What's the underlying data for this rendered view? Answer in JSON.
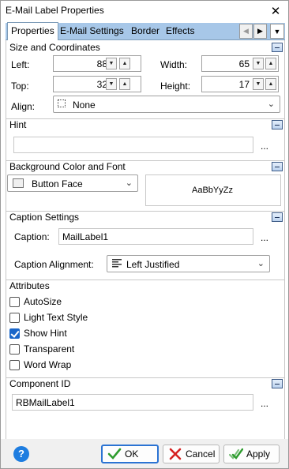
{
  "window": {
    "title": "E-Mail Label Properties"
  },
  "tabs": [
    "Properties",
    "E-Mail Settings",
    "Border",
    "Effects"
  ],
  "size": {
    "header": "Size and Coordinates",
    "left_label": "Left:",
    "left_value": "88",
    "width_label": "Width:",
    "width_value": "65",
    "top_label": "Top:",
    "top_value": "32",
    "height_label": "Height:",
    "height_value": "17",
    "align_label": "Align:",
    "align_value": "None"
  },
  "hint": {
    "header": "Hint",
    "value": "",
    "browse": "..."
  },
  "background": {
    "header": "Background Color and Font",
    "color_value": "Button Face",
    "font_preview": "AaBbYyZz"
  },
  "caption": {
    "header": "Caption Settings",
    "caption_label": "Caption:",
    "caption_value": "MailLabel1",
    "browse": "...",
    "alignment_label": "Caption Alignment:",
    "alignment_value": "Left Justified"
  },
  "attributes": {
    "header": "Attributes",
    "items": [
      {
        "label": "AutoSize",
        "checked": false
      },
      {
        "label": "Light Text Style",
        "checked": false
      },
      {
        "label": "Show Hint",
        "checked": true
      },
      {
        "label": "Transparent",
        "checked": false
      },
      {
        "label": "Word Wrap",
        "checked": false
      }
    ]
  },
  "component": {
    "header": "Component ID",
    "value": "RBMailLabel1",
    "browse": "..."
  },
  "footer": {
    "ok": "OK",
    "cancel": "Cancel",
    "apply": "Apply",
    "help": "?"
  },
  "colors": {
    "tab_bar": "#a7c7e8",
    "check_on": "#1a66c9",
    "ok_icon": "#2e9c2e",
    "cancel_icon": "#d52020",
    "help": "#1e7de0"
  }
}
